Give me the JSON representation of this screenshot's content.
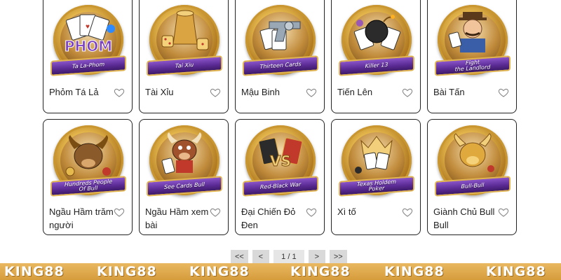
{
  "games": [
    {
      "ribbon": "Ta La-Phom",
      "title": "Phỏm Tá Lả",
      "icon": "phom-cards-icon"
    },
    {
      "ribbon": "Tai Xiu",
      "title": "Tài Xỉu",
      "icon": "dice-cup-icon"
    },
    {
      "ribbon": "Thirteen Cards",
      "title": "Mậu Binh",
      "icon": "revolver-cards-icon"
    },
    {
      "ribbon": "Killer 13",
      "title": "Tiến Lên",
      "icon": "bomb-cards-icon"
    },
    {
      "ribbon": "Fight\nthe Landlord",
      "title": "Bài Tấn",
      "icon": "landlord-character-icon"
    },
    {
      "ribbon": "Hundreds People\nOf Bull",
      "title": "Ngầu Hầm trăm người",
      "icon": "bull-head-icon"
    },
    {
      "ribbon": "See Cards Bull",
      "title": "Ngầu Hầm xem bài",
      "icon": "bull-mascot-icon"
    },
    {
      "ribbon": "Red-Black War",
      "title": "Đại Chiến Đỏ Đen",
      "icon": "versus-cards-icon"
    },
    {
      "ribbon": "Texas Holdem\nPoker",
      "title": "Xì tố",
      "icon": "crown-cards-icon"
    },
    {
      "ribbon": "Bull-Bull",
      "title": "Giành Chủ Bull Bull",
      "icon": "golden-bull-icon"
    }
  ],
  "pagination": {
    "first": "<<",
    "prev": "<",
    "current": "1 / 1",
    "next": ">",
    "last": ">>"
  },
  "banner": {
    "brand": "KING88"
  },
  "colors": {
    "ribbon_purple": "#5a2a93",
    "gold": "#d69c3c",
    "heart_outline": "#888888"
  }
}
